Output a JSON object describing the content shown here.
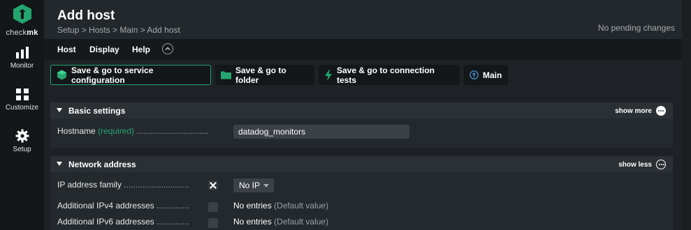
{
  "sidebar": {
    "logo_prefix": "check",
    "logo_suffix": "mk",
    "items": [
      {
        "label": "Monitor",
        "icon": "bar-chart-icon"
      },
      {
        "label": "Customize",
        "icon": "grid-icon"
      },
      {
        "label": "Setup",
        "icon": "gear-icon"
      }
    ]
  },
  "header": {
    "title": "Add host",
    "breadcrumb": "Setup > Hosts > Main > Add host",
    "pending": "No pending changes"
  },
  "menubar": {
    "items": [
      "Host",
      "Display",
      "Help"
    ],
    "toggle_icon": "chevron-up-circle-icon"
  },
  "actions": [
    {
      "label": "Save & go to service configuration",
      "icon": "cube-icon"
    },
    {
      "label": "Save & go to folder",
      "icon": "folder-icon"
    },
    {
      "label": "Save & go to connection tests",
      "icon": "lightning-icon"
    },
    {
      "label": "Main",
      "icon": "arrow-up-circle-icon"
    }
  ],
  "sections": {
    "basic": {
      "title": "Basic settings",
      "toggle": "show more",
      "hostname_label": "Hostname",
      "hostname_required": "(required)",
      "hostname_leader": " ...............................",
      "hostname_value": "datadog_monitors"
    },
    "network": {
      "title": "Network address",
      "toggle": "show less",
      "ip_family_label": "IP address family",
      "ip_family_leader": " ............................",
      "ip_family_value": "No IP",
      "ipv4_label": "Additional IPv4 addresses",
      "ipv4_leader": " ..............",
      "ipv4_value": "No entries",
      "ipv4_default": "(Default value)",
      "ipv6_label": "Additional IPv6 addresses",
      "ipv6_leader": " ..............",
      "ipv6_value": "No entries",
      "ipv6_default": "(Default value)"
    }
  },
  "colors": {
    "accent": "#24a56f",
    "sidebar_bg": "#14171a",
    "page_bg": "#1e2226"
  }
}
